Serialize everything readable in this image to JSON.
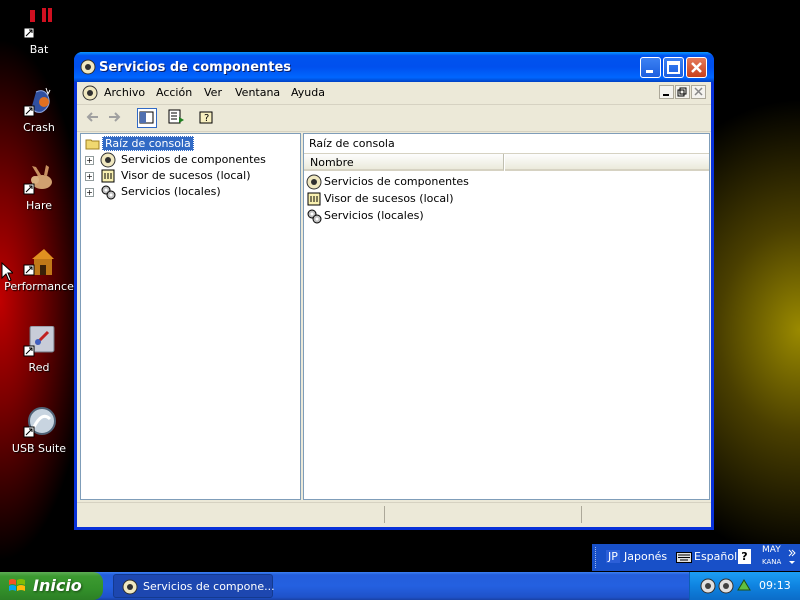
{
  "desktop": {
    "icons": [
      {
        "label": "Bat",
        "icon": "bat-icon"
      },
      {
        "label": "Crash",
        "icon": "crash-icon"
      },
      {
        "label": "Hare",
        "icon": "hare-icon"
      },
      {
        "label": "Performance",
        "icon": "performance-icon"
      },
      {
        "label": "Red",
        "icon": "red-icon"
      },
      {
        "label": "USB Suite",
        "icon": "usb-suite-icon"
      }
    ]
  },
  "window": {
    "title": "Servicios de componentes",
    "menu": [
      "Archivo",
      "Acción",
      "Ver",
      "Ventana",
      "Ayuda"
    ],
    "tree": {
      "root": "Raíz de consola",
      "items": [
        "Servicios de componentes",
        "Visor de sucesos (local)",
        "Servicios (locales)"
      ]
    },
    "right_pane": {
      "header": "Raíz de consola",
      "column": "Nombre",
      "items": [
        "Servicios de componentes",
        "Visor de sucesos (local)",
        "Servicios (locales)"
      ]
    }
  },
  "language_bar": {
    "lang_code": "JP",
    "language": "Japonés",
    "keyboard": "Español",
    "help": "?",
    "caps": "MAY",
    "kana": "KANA"
  },
  "taskbar": {
    "start_label": "Inicio",
    "task_label": "Servicios de compone...",
    "clock": "09:13"
  },
  "colors": {
    "title_blue": "#0053ee",
    "start_green": "#33912a",
    "selection": "#316ac5"
  }
}
